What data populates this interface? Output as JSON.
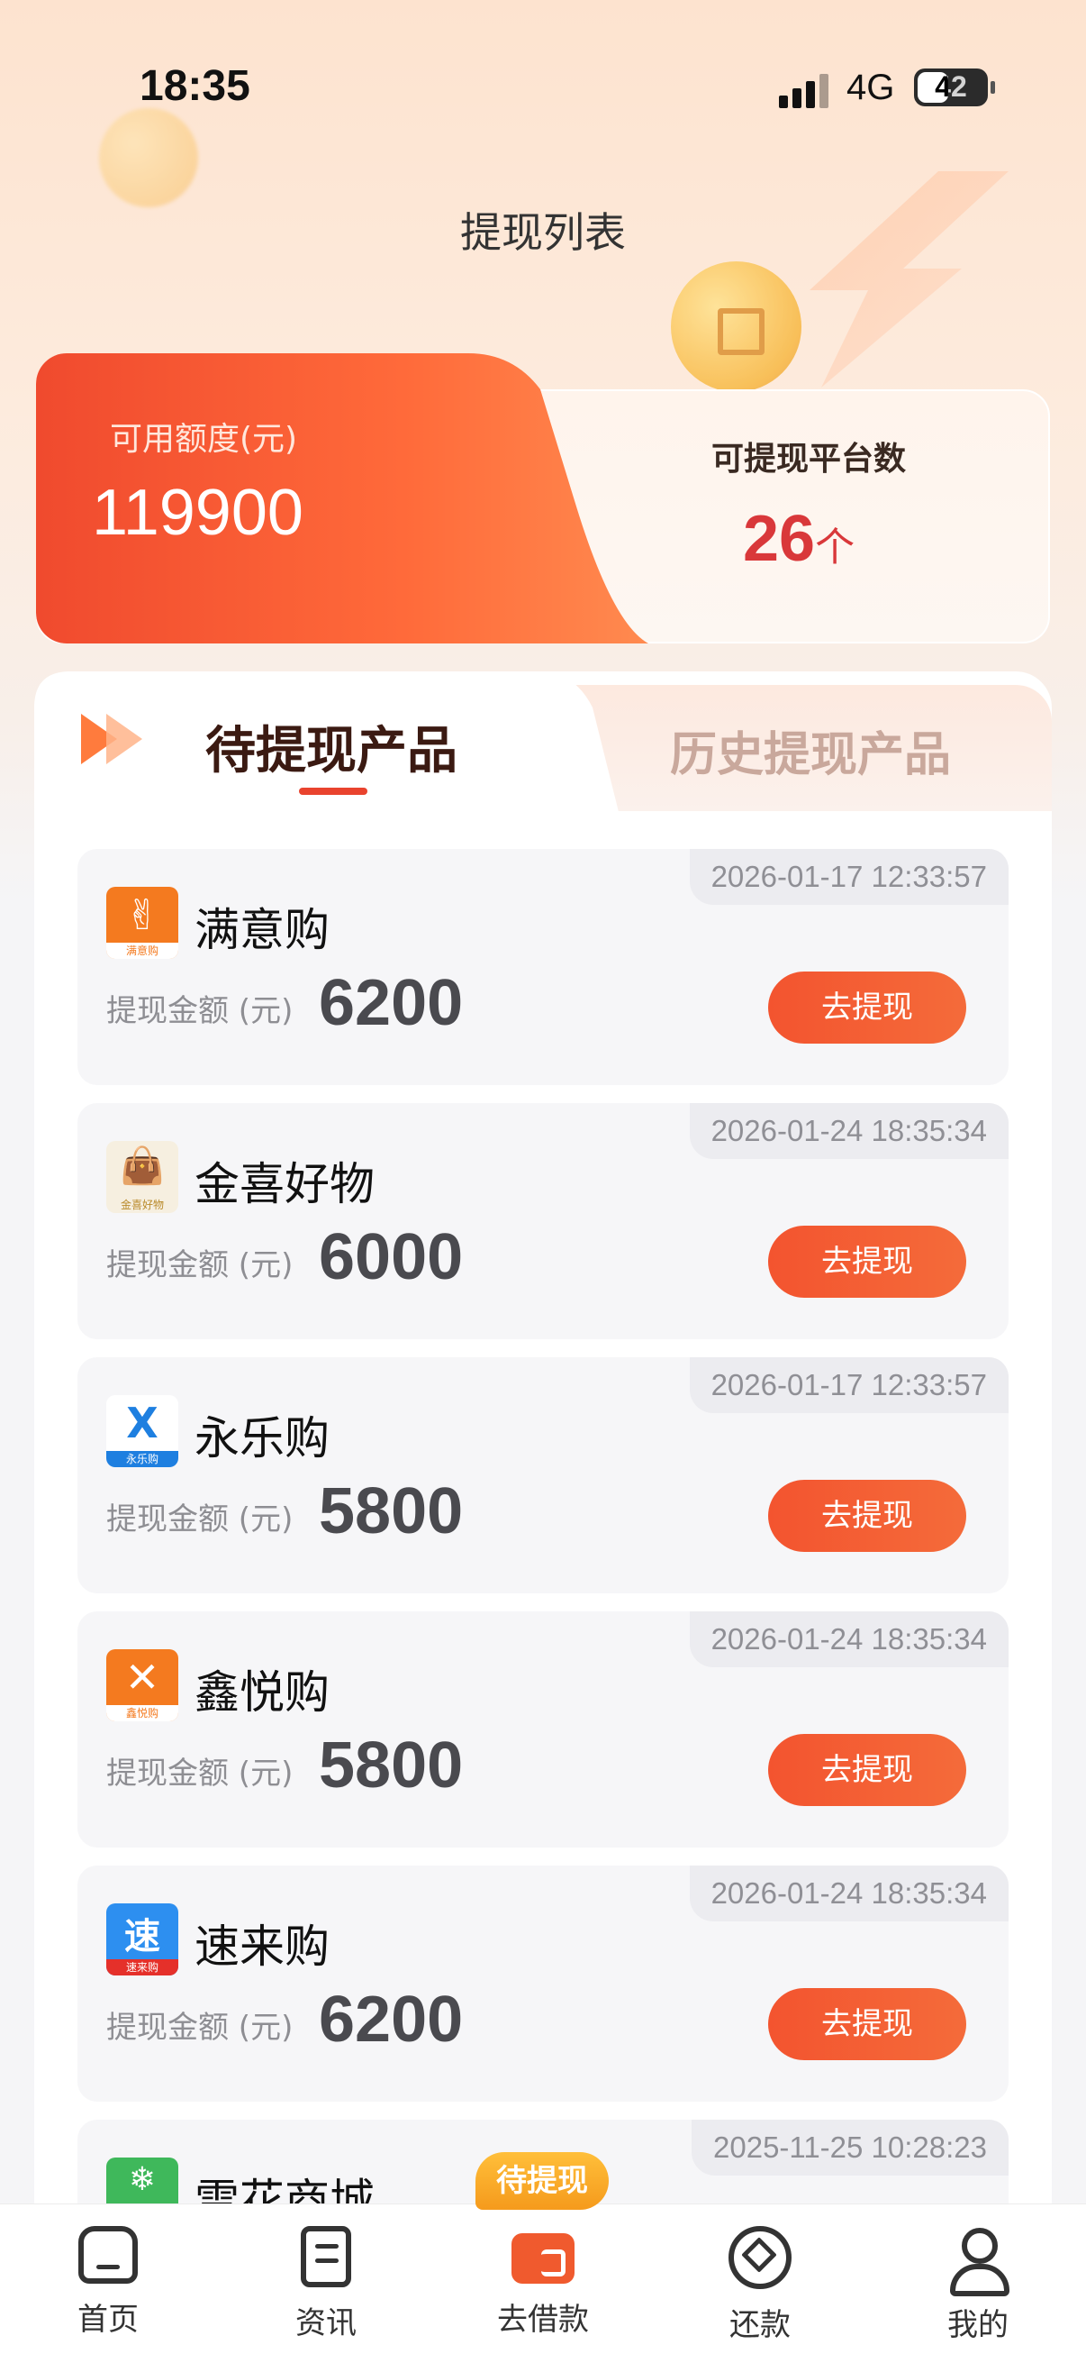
{
  "status_bar": {
    "time": "18:35",
    "network": "4G",
    "battery": "42"
  },
  "page": {
    "title": "提现列表"
  },
  "summary": {
    "available_label": "可用额度(元)",
    "available_value": "119900",
    "platforms_label": "可提现平台数",
    "platforms_count": "26",
    "platforms_unit": "个"
  },
  "tabs": {
    "active": "待提现产品",
    "history": "历史提现产品"
  },
  "amount_label": "提现金额 (元)",
  "withdraw_button": "去提现",
  "products": [
    {
      "name": "满意购",
      "timestamp": "2026-01-17 12:33:57",
      "amount": "6200",
      "logo_caption": "满意购",
      "logo_color": "#f47a1f"
    },
    {
      "name": "金喜好物",
      "timestamp": "2026-01-24 18:35:34",
      "amount": "6000",
      "logo_caption": "金喜好物",
      "logo_color": "#f3e7cf"
    },
    {
      "name": "永乐购",
      "timestamp": "2026-01-17 12:33:57",
      "amount": "5800",
      "logo_caption": "永乐购",
      "logo_color": "#1e7fe0"
    },
    {
      "name": "鑫悦购",
      "timestamp": "2026-01-24 18:35:34",
      "amount": "5800",
      "logo_caption": "鑫悦购",
      "logo_color": "#f47a1f"
    },
    {
      "name": "速来购",
      "timestamp": "2026-01-24 18:35:34",
      "amount": "6200",
      "logo_caption": "速来购",
      "logo_color": "#1e7fe0"
    },
    {
      "name": "雪花商城",
      "timestamp": "2025-11-25 10:28:23",
      "amount": "",
      "logo_caption": "",
      "logo_color": "#3fb85b"
    }
  ],
  "bottom_nav": {
    "badge": "待提现",
    "items": [
      {
        "label": "首页",
        "icon": "home-icon"
      },
      {
        "label": "资讯",
        "icon": "news-icon"
      },
      {
        "label": "去借款",
        "icon": "wallet-icon"
      },
      {
        "label": "还款",
        "icon": "repay-icon"
      },
      {
        "label": "我的",
        "icon": "user-icon"
      }
    ]
  },
  "colors": {
    "accent": "#f3542f",
    "count_red": "#d9383a"
  }
}
